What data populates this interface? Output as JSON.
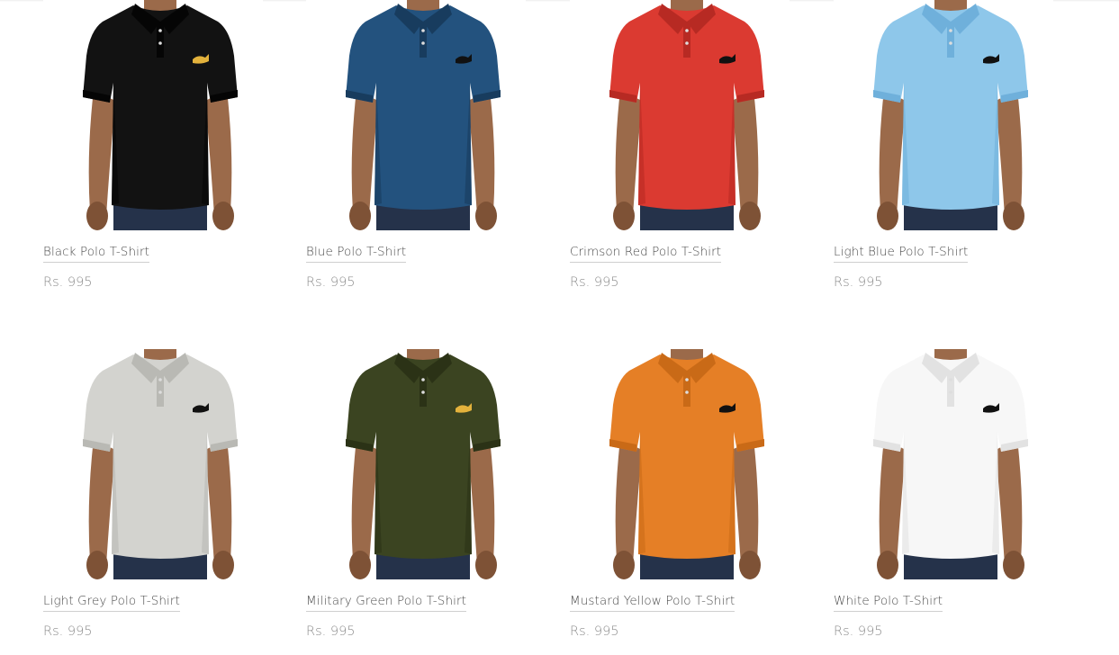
{
  "products": [
    {
      "name": "Black Polo T-Shirt",
      "price": "Rs. 995",
      "shirt_color": "#121212",
      "shade": "#050505",
      "logo_color": "#e3b23c"
    },
    {
      "name": "Blue Polo T-Shirt",
      "price": "Rs. 995",
      "shirt_color": "#23527e",
      "shade": "#183c5e",
      "logo_color": "#111111"
    },
    {
      "name": "Crimson Red Polo T-Shirt",
      "price": "Rs. 995",
      "shirt_color": "#db3a31",
      "shade": "#b72a23",
      "logo_color": "#111111"
    },
    {
      "name": "Light Blue Polo T-Shirt",
      "price": "Rs. 995",
      "shirt_color": "#8ec7ea",
      "shade": "#6fb0db",
      "logo_color": "#111111"
    },
    {
      "name": "Light Grey Polo T-Shirt",
      "price": "Rs. 995",
      "shirt_color": "#d3d3cf",
      "shade": "#b9b9b4",
      "logo_color": "#111111"
    },
    {
      "name": "Military Green Polo T-Shirt",
      "price": "Rs. 995",
      "shirt_color": "#3b4421",
      "shade": "#2b3216",
      "logo_color": "#e3b23c"
    },
    {
      "name": "Mustard Yellow Polo T-Shirt",
      "price": "Rs. 995",
      "shirt_color": "#e57f26",
      "shade": "#c96a17",
      "logo_color": "#111111"
    },
    {
      "name": "White Polo T-Shirt",
      "price": "Rs. 995",
      "shirt_color": "#f7f7f7",
      "shade": "#e2e2e2",
      "logo_color": "#111111"
    }
  ],
  "colors": {
    "skin": "#9b6a4a",
    "skin_shade": "#7e5236",
    "jeans": "#25324a"
  }
}
